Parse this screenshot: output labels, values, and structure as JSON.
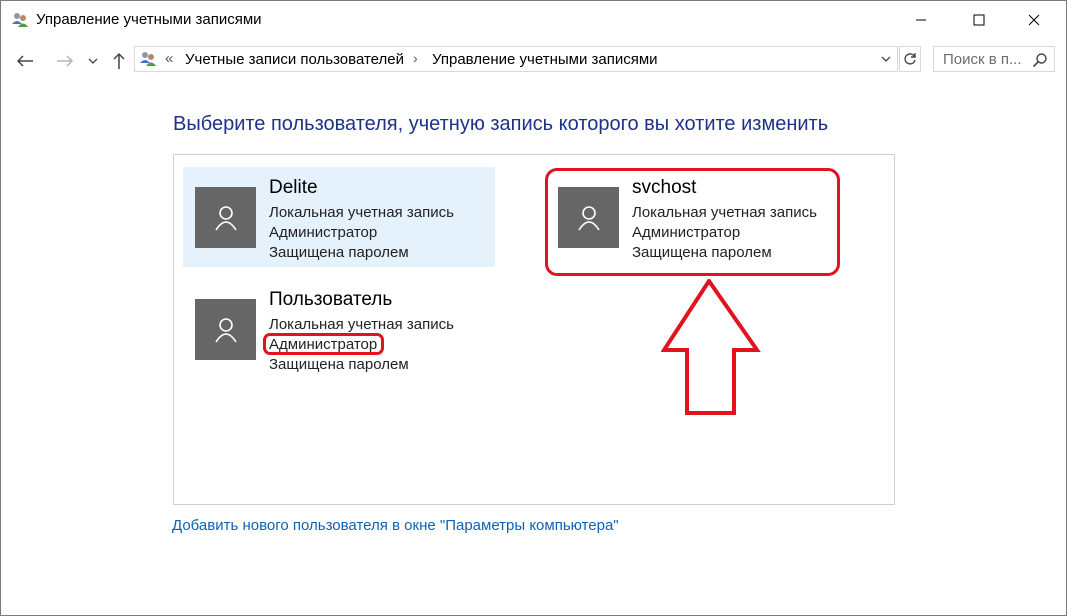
{
  "window": {
    "title": "Управление учетными записями"
  },
  "address": {
    "arrows": "«",
    "crumbs": [
      "Учетные записи пользователей",
      "Управление учетными записями"
    ],
    "separator": "›"
  },
  "search": {
    "placeholder": "Поиск в п..."
  },
  "content": {
    "heading": "Выберите пользователя, учетную запись которого вы хотите изменить",
    "users": [
      {
        "name": "Delite",
        "type": "Локальная учетная запись",
        "role": "Администратор",
        "security": "Защищена паролем",
        "selected": true
      },
      {
        "name": "svchost",
        "type": "Локальная учетная запись",
        "role": "Администратор",
        "security": "Защищена паролем",
        "selected": false
      },
      {
        "name": "Пользователь",
        "type": "Локальная учетная запись",
        "role": "Администратор",
        "security": "Защищена паролем",
        "selected": false
      }
    ],
    "add_link": "Добавить нового пользователя в окне \"Параметры компьютера\""
  },
  "colors": {
    "heading": "#1e3287",
    "link": "#0e62b5",
    "avatar": "#666666",
    "selected_bg": "#e5f1fb",
    "annotation": "#e0131e"
  },
  "icons": {
    "title": "users-icon",
    "back": "back-arrow-icon",
    "forward": "forward-arrow-icon",
    "recent": "chevron-down-icon",
    "up": "up-arrow-icon",
    "refresh": "refresh-icon",
    "search": "search-icon",
    "avatar": "user-silhouette-icon"
  }
}
